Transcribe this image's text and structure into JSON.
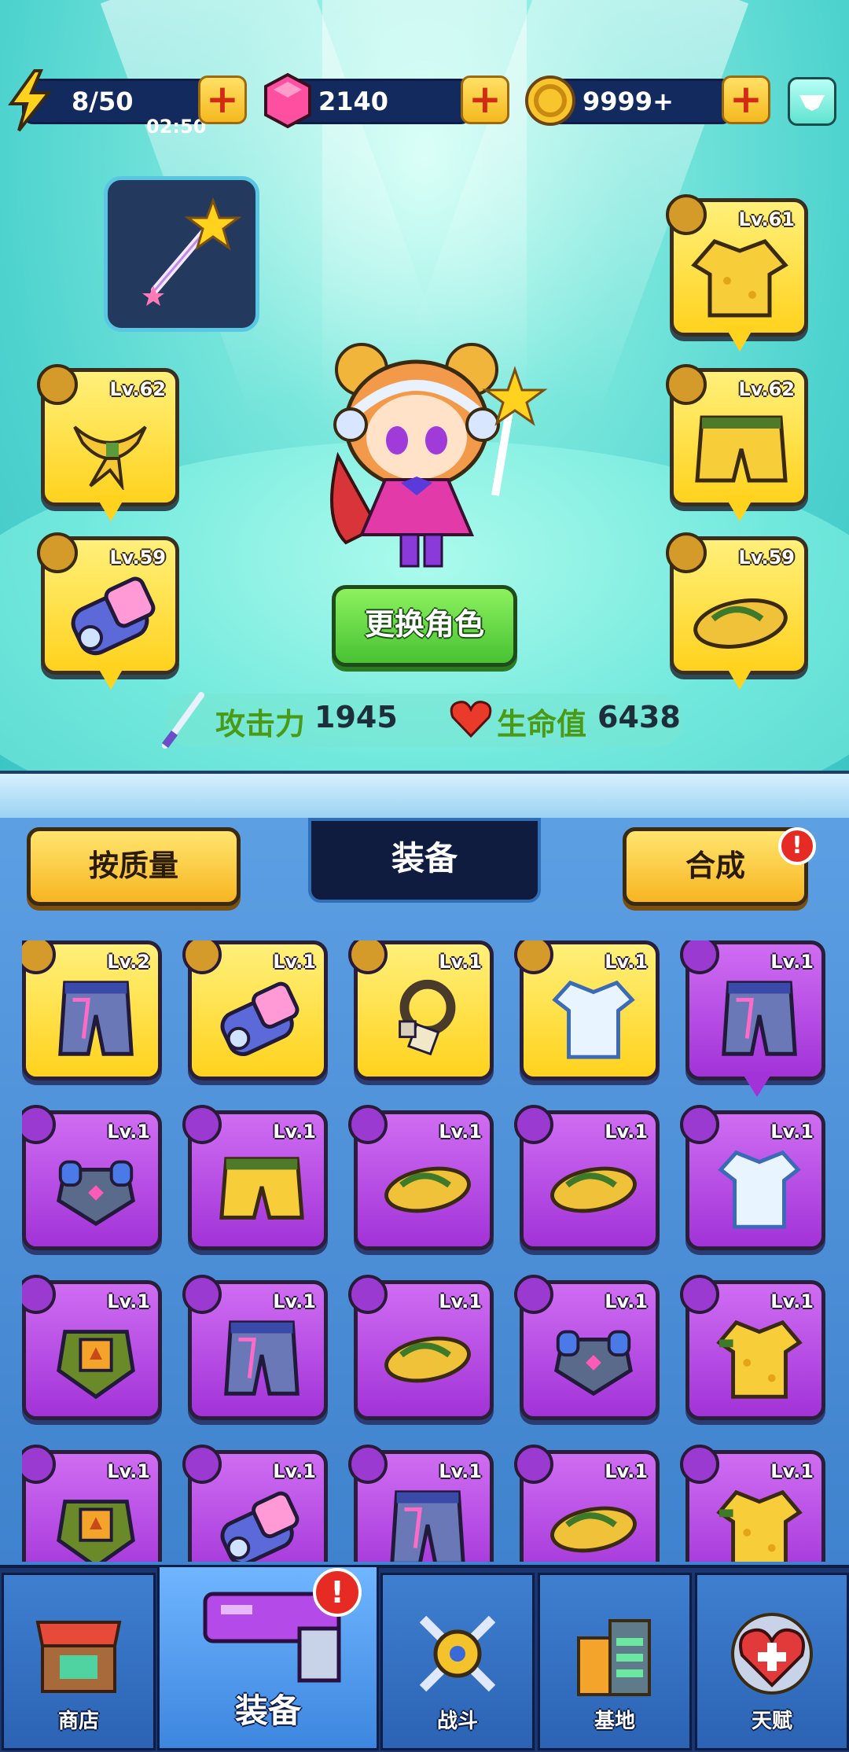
{
  "topbar": {
    "energy": {
      "value": "8/50",
      "timer": "02:50"
    },
    "gems": {
      "value": "2140"
    },
    "coins": {
      "value": "9999+"
    }
  },
  "hero": {
    "change_label": "更换角色",
    "attack_label": "攻击力",
    "attack_value": "1945",
    "hp_label": "生命值",
    "hp_value": "6438"
  },
  "equipped": {
    "necklace": {
      "level": "Lv.62"
    },
    "gloves": {
      "level": "Lv.59"
    },
    "shirt": {
      "level": "Lv.61"
    },
    "shorts": {
      "level": "Lv.62"
    },
    "shoes": {
      "level": "Lv.59"
    }
  },
  "panel": {
    "sort_label": "按质量",
    "active_tab": "装备",
    "merge_label": "合成",
    "alert": "!"
  },
  "inventory": [
    {
      "type": "pants",
      "quality": "yellow",
      "level": "Lv.2"
    },
    {
      "type": "gloves",
      "quality": "yellow",
      "level": "Lv.1"
    },
    {
      "type": "necklace",
      "quality": "yellow",
      "level": "Lv.1"
    },
    {
      "type": "shirt",
      "quality": "yellow",
      "level": "Lv.1"
    },
    {
      "type": "pants",
      "quality": "purple",
      "level": "Lv.1"
    },
    {
      "type": "armor",
      "quality": "purple",
      "level": "Lv.1"
    },
    {
      "type": "shorts",
      "quality": "purple",
      "level": "Lv.1"
    },
    {
      "type": "shoes",
      "quality": "purple",
      "level": "Lv.1"
    },
    {
      "type": "shoes",
      "quality": "purple",
      "level": "Lv.1"
    },
    {
      "type": "shirt",
      "quality": "purple",
      "level": "Lv.1"
    },
    {
      "type": "armor-green",
      "quality": "purple",
      "level": "Lv.1"
    },
    {
      "type": "pants",
      "quality": "purple",
      "level": "Lv.1"
    },
    {
      "type": "shoes",
      "quality": "purple",
      "level": "Lv.1"
    },
    {
      "type": "armor",
      "quality": "purple",
      "level": "Lv.1"
    },
    {
      "type": "shirt-yellow",
      "quality": "purple",
      "level": "Lv.1"
    },
    {
      "type": "armor-green",
      "quality": "purple",
      "level": "Lv.1"
    },
    {
      "type": "gloves",
      "quality": "purple",
      "level": "Lv.1"
    },
    {
      "type": "pants",
      "quality": "purple",
      "level": "Lv.1"
    },
    {
      "type": "shoes",
      "quality": "purple",
      "level": "Lv.1"
    },
    {
      "type": "shirt-yellow",
      "quality": "purple",
      "level": "Lv.1"
    }
  ],
  "nav": {
    "shop": "商店",
    "equipment": "装备",
    "battle": "战斗",
    "base": "基地",
    "talent": "天赋",
    "alert": "!"
  },
  "colors": {
    "yellow_quality": "#ffd21d",
    "purple_quality": "#a233d8",
    "panel_blue": "#4a8fd8",
    "navy": "#132a5e"
  }
}
